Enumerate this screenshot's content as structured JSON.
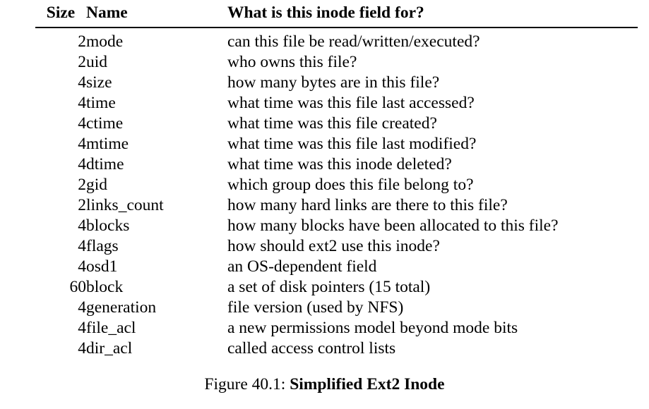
{
  "figure": {
    "caption_label": "Figure 40.1:",
    "caption_title": "Simplified Ext2 Inode"
  },
  "table": {
    "headers": {
      "size": "Size",
      "name": "Name",
      "description": "What is this inode field for?"
    },
    "rows": [
      {
        "size": "2",
        "name": "mode",
        "description": "can this file be read/written/executed?"
      },
      {
        "size": "2",
        "name": "uid",
        "description": "who owns this file?"
      },
      {
        "size": "4",
        "name": "size",
        "description": "how many bytes are in this file?"
      },
      {
        "size": "4",
        "name": "time",
        "description": "what time was this file last accessed?"
      },
      {
        "size": "4",
        "name": "ctime",
        "description": "what time was this file created?"
      },
      {
        "size": "4",
        "name": "mtime",
        "description": "what time was this file last modified?"
      },
      {
        "size": "4",
        "name": "dtime",
        "description": "what time was this inode deleted?"
      },
      {
        "size": "2",
        "name": "gid",
        "description": "which group does this file belong to?"
      },
      {
        "size": "2",
        "name": "links_count",
        "description": "how many hard links are there to this file?"
      },
      {
        "size": "4",
        "name": "blocks",
        "description": "how many blocks have been allocated to this file?"
      },
      {
        "size": "4",
        "name": "flags",
        "description": "how should ext2 use this inode?"
      },
      {
        "size": "4",
        "name": "osd1",
        "description": "an OS-dependent field"
      },
      {
        "size": "60",
        "name": "block",
        "description": "a set of disk pointers (15 total)"
      },
      {
        "size": "4",
        "name": "generation",
        "description": "file version (used by NFS)"
      },
      {
        "size": "4",
        "name": "file_acl",
        "description": "a new permissions model beyond mode bits"
      },
      {
        "size": "4",
        "name": "dir_acl",
        "description": "called access control lists"
      }
    ]
  },
  "colors": {
    "text": "#000000",
    "background": "#ffffff",
    "rule": "#000000"
  }
}
